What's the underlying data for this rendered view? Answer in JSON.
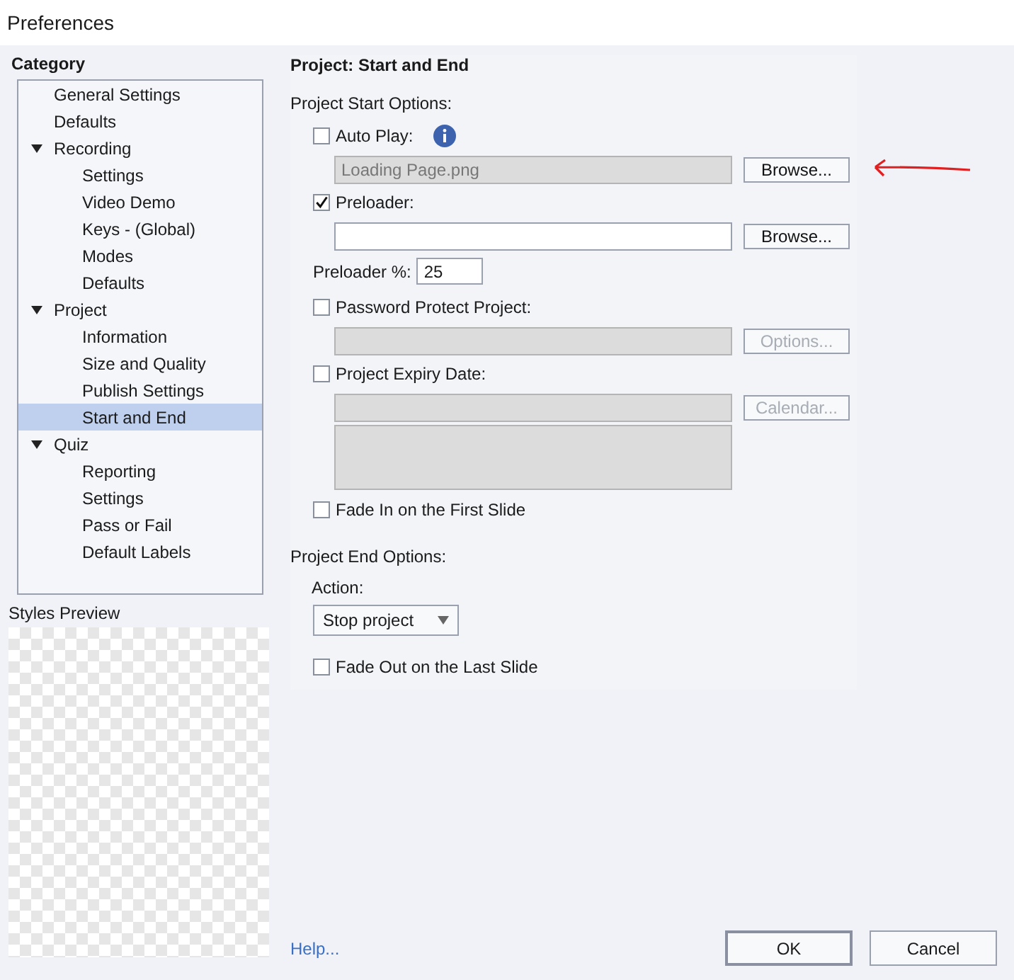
{
  "window": {
    "title": "Preferences"
  },
  "category": {
    "heading": "Category",
    "items": [
      {
        "label": "General Settings",
        "selected": false
      },
      {
        "label": "Defaults",
        "selected": false
      },
      {
        "label": "Recording",
        "selected": false,
        "expanded": true,
        "children": [
          {
            "label": "Settings",
            "selected": false
          },
          {
            "label": "Video Demo",
            "selected": false
          },
          {
            "label": "Keys - (Global)",
            "selected": false
          },
          {
            "label": "Modes",
            "selected": false
          },
          {
            "label": "Defaults",
            "selected": false
          }
        ]
      },
      {
        "label": "Project",
        "selected": false,
        "expanded": true,
        "children": [
          {
            "label": "Information",
            "selected": false
          },
          {
            "label": "Size and Quality",
            "selected": false
          },
          {
            "label": "Publish Settings",
            "selected": false
          },
          {
            "label": "Start and End",
            "selected": true
          }
        ]
      },
      {
        "label": "Quiz",
        "selected": false,
        "expanded": true,
        "children": [
          {
            "label": "Reporting",
            "selected": false
          },
          {
            "label": "Settings",
            "selected": false
          },
          {
            "label": "Pass or Fail",
            "selected": false
          },
          {
            "label": "Default Labels",
            "selected": false
          }
        ]
      }
    ]
  },
  "styles_preview": {
    "label": "Styles Preview"
  },
  "panel": {
    "title": "Project: Start and End",
    "start_heading": "Project Start Options:",
    "start_options": [
      {
        "kind": "checkbox",
        "label": "Auto Play:",
        "checked": false,
        "info": true
      },
      {
        "kind": "file",
        "value": "Loading Page.png",
        "disabled": true,
        "button": "Browse...",
        "button_disabled": false,
        "annotated": true
      },
      {
        "kind": "checkbox",
        "label": "Preloader:",
        "checked": true
      },
      {
        "kind": "file",
        "disabled": false,
        "button": "Browse...",
        "button_disabled": false
      },
      {
        "kind": "number",
        "label": "Preloader %:",
        "value": "25"
      },
      {
        "kind": "checkbox",
        "label": "Password Protect Project:",
        "checked": false
      },
      {
        "kind": "file",
        "disabled": true,
        "button": "Options...",
        "button_disabled": true
      },
      {
        "kind": "checkbox",
        "label": "Project Expiry Date:",
        "checked": false
      },
      {
        "kind": "file",
        "disabled": true,
        "button": "Calendar...",
        "button_disabled": true
      },
      {
        "kind": "textarea",
        "disabled": true
      },
      {
        "kind": "checkbox",
        "label": "Fade In on the First Slide",
        "checked": false
      }
    ],
    "end_heading": "Project End Options:",
    "action_label": "Action:",
    "action_value": "Stop project",
    "fade_out": {
      "label": "Fade Out on the Last Slide",
      "checked": false
    }
  },
  "help_link": "Help...",
  "buttons": [
    {
      "label": "OK",
      "default": true
    },
    {
      "label": "Cancel",
      "default": false
    }
  ]
}
